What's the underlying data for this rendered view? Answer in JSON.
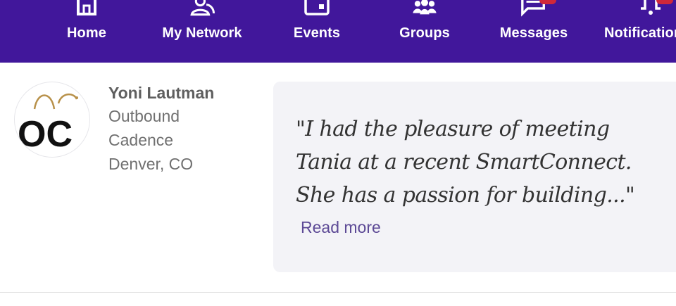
{
  "nav": {
    "items": [
      {
        "label": "Home",
        "icon": "home-icon"
      },
      {
        "label": "My Network",
        "icon": "network-icon"
      },
      {
        "label": "Events",
        "icon": "calendar-icon"
      },
      {
        "label": "Groups",
        "icon": "groups-icon"
      },
      {
        "label": "Messages",
        "icon": "messages-icon"
      },
      {
        "label": "Notifications",
        "icon": "bell-icon"
      }
    ],
    "colors": {
      "bar": "#41179b",
      "badge": "#d0283a"
    }
  },
  "profile": {
    "avatar_text": "OC",
    "name": "Yoni Lautman",
    "company_line1": "Outbound",
    "company_line2": "Cadence",
    "location": "Denver, CO"
  },
  "testimonial": {
    "quote": "\"I had the pleasure of meeting\n Tania at a recent SmartConnect.\n She has a passion for building...\"",
    "read_more": "Read more"
  }
}
